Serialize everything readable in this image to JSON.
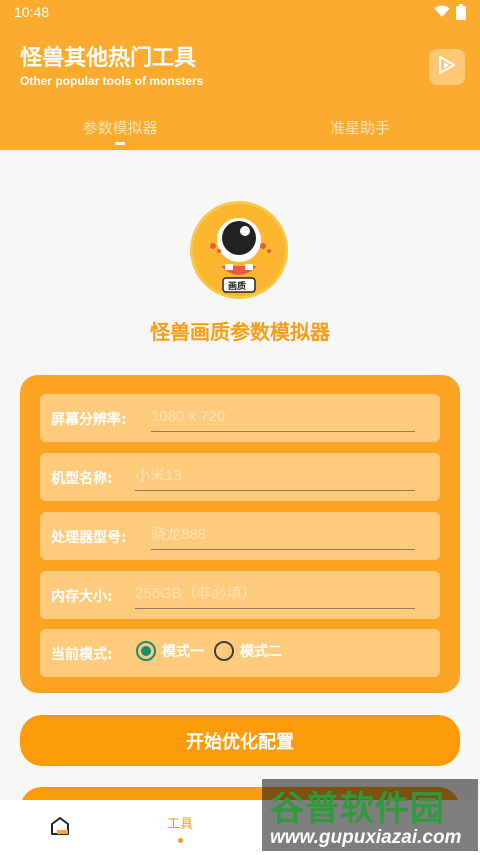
{
  "status_bar": {
    "time": "10:48"
  },
  "header": {
    "title": "怪兽其他热门工具",
    "subtitle": "Other popular tools of monsters",
    "tabs": [
      {
        "label": "参数模拟器",
        "active": true
      },
      {
        "label": "准星助手",
        "active": false
      }
    ]
  },
  "app": {
    "name": "怪兽画质参数模拟器",
    "logo_badge": "画质"
  },
  "form": {
    "resolution": {
      "label": "屏幕分辨率:",
      "placeholder": "1080 x 720",
      "value": ""
    },
    "model": {
      "label": "机型名称:",
      "placeholder": "小米13",
      "value": ""
    },
    "processor": {
      "label": "处理器型号:",
      "placeholder": "骁龙888",
      "value": ""
    },
    "memory": {
      "label": "内存大小:",
      "placeholder": "256GB（非必填）",
      "value": ""
    },
    "mode": {
      "label": "当前模式:",
      "options": [
        {
          "label": "模式一",
          "checked": true
        },
        {
          "label": "模式二",
          "checked": false
        }
      ]
    }
  },
  "actions": {
    "start": "开始优化配置"
  },
  "bottom_nav": {
    "items": [
      {
        "icon": "home-icon",
        "label": ""
      },
      {
        "icon": "tools",
        "label": "工具",
        "active": true
      },
      {
        "icon": "unknown-icon",
        "label": ""
      },
      {
        "icon": "unknown-icon",
        "label": ""
      }
    ]
  },
  "watermark": {
    "top": "谷普软件园",
    "bottom": "www.gupuxiazai.com"
  },
  "colors": {
    "accent": "#fdab2e",
    "button": "#fd9b0a",
    "field": "#fecb7c",
    "radio_checked": "#188c73"
  }
}
